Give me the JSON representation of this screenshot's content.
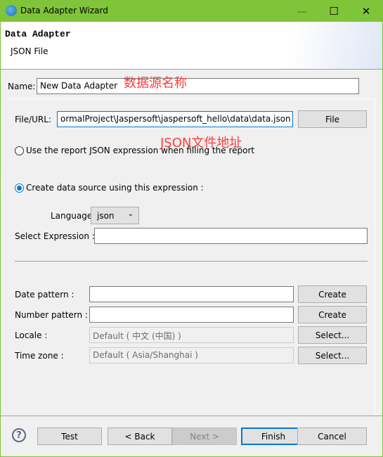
{
  "window": {
    "title": "Data Adapter Wizard",
    "minimize": "—",
    "maximize": "☐",
    "close": "✕"
  },
  "header": {
    "title": "Data Adapter",
    "subtitle": "JSON File"
  },
  "form": {
    "name_label": "Name:",
    "name_value": "New Data Adapter",
    "file_label": "File/URL:",
    "file_value": "ormalProject\\Jaspersoft\\jaspersoft_hello\\data\\data.json",
    "file_button": "File",
    "radio_report": "Use the report JSON expression when filling the report",
    "radio_create": "Create data source using this expression :",
    "selected_radio": "create",
    "language_label": "Language",
    "language_value": "json",
    "select_expr_label": "Select Expression :",
    "select_expr_value": "",
    "date_label": "Date pattern :",
    "date_value": "",
    "date_button": "Create",
    "number_label": "Number pattern :",
    "number_value": "",
    "number_button": "Create",
    "locale_label": "Locale :",
    "locale_value": "Default ( 中文 (中国) )",
    "locale_button": "Select...",
    "tz_label": "Time zone :",
    "tz_value": "Default ( Asia/Shanghai )",
    "tz_button": "Select..."
  },
  "annotations": {
    "name_note": "数据源名称",
    "file_note": "JSON文件地址"
  },
  "footer": {
    "help": "?",
    "test": "Test",
    "back": "< Back",
    "next": "Next >",
    "finish": "Finish",
    "cancel": "Cancel"
  },
  "colors": {
    "titlebar": "#80c43a",
    "accent": "#0078d7",
    "annotation": "#ff3b3b"
  }
}
